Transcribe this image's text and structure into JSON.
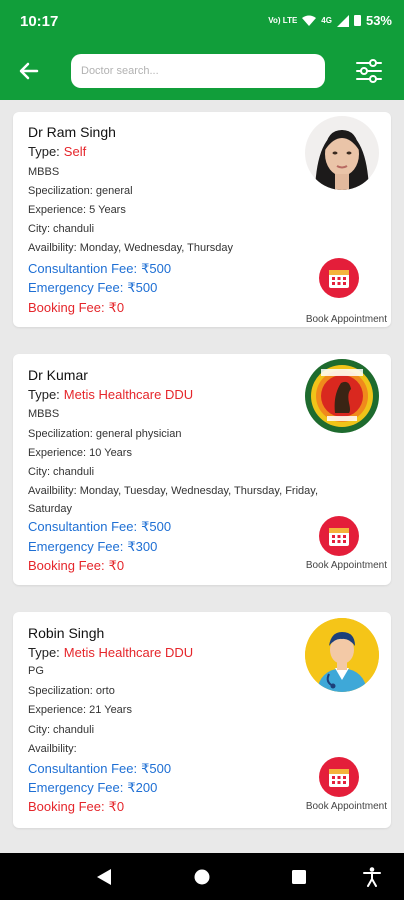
{
  "status_bar": {
    "time": "10:17",
    "network_top": "Vo) LTE",
    "signal_label": "4G",
    "battery": "53%"
  },
  "header": {
    "search_placeholder": "Doctor search..."
  },
  "doctors": [
    {
      "name": "Dr Ram Singh",
      "type_label": "Type:",
      "type_value": "Self",
      "degree": "MBBS",
      "specialization": "Specilization: general",
      "experience": "Experience: 5 Years",
      "city": "City: chanduli",
      "availability": "Availbility: Monday, Wednesday, Thursday",
      "consultation_label": "Consultantion Fee:",
      "consultation_fee": "₹500",
      "emergency_label": "Emergency Fee:",
      "emergency_fee": "₹500",
      "booking_label": "Booking Fee:",
      "booking_fee": "₹0",
      "book_label": "Book Appointment"
    },
    {
      "name": "Dr Kumar",
      "type_label": "Type:",
      "type_value": "Metis Healthcare DDU",
      "degree": "MBBS",
      "specialization": "Specilization: general physician",
      "experience": "Experience: 10 Years",
      "city": "City: chanduli",
      "availability": "Availbility: Monday, Tuesday, Wednesday, Thursday, Friday, Saturday",
      "consultation_label": "Consultantion Fee:",
      "consultation_fee": "₹500",
      "emergency_label": "Emergency Fee:",
      "emergency_fee": "₹300",
      "booking_label": "Booking Fee:",
      "booking_fee": "₹0",
      "book_label": "Book Appointment"
    },
    {
      "name": "Robin Singh",
      "type_label": "Type:",
      "type_value": "Metis Healthcare DDU",
      "degree": "PG",
      "specialization": "Specilization: orto",
      "experience": "Experience: 21 Years",
      "city": "City: chanduli",
      "availability": "Availbility:",
      "consultation_label": "Consultantion Fee:",
      "consultation_fee": "₹500",
      "emergency_label": "Emergency Fee:",
      "emergency_fee": "₹200",
      "booking_label": "Booking Fee:",
      "booking_fee": "₹0",
      "book_label": "Book Appointment"
    }
  ],
  "colors": {
    "brand_green": "#119e3a",
    "fee_blue": "#1e6fd4",
    "accent_red": "#e5262b",
    "book_icon": "#e41e3a"
  }
}
